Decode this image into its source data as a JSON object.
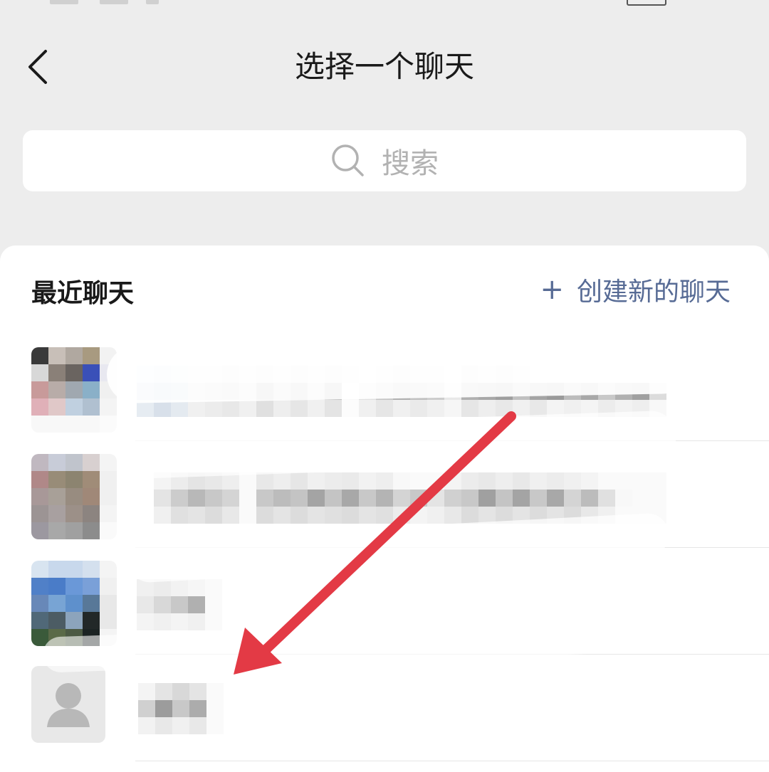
{
  "header": {
    "title": "选择一个聊天",
    "back_icon": "chevron-left-icon"
  },
  "search": {
    "placeholder": "搜索",
    "icon": "search-icon"
  },
  "recent": {
    "section_title": "最近聊天",
    "create_label": "创建新的聊天",
    "create_icon": "plus-icon"
  },
  "colors": {
    "accent": "#576b95",
    "background": "#ededed",
    "annotation_arrow": "#e33a45"
  },
  "chats": [
    {
      "avatar": "blurred-avatar",
      "name": ""
    },
    {
      "avatar": "blurred-avatar",
      "name": ""
    },
    {
      "avatar": "blurred-avatar",
      "name": ""
    },
    {
      "avatar": "default-person-avatar",
      "name": ""
    }
  ]
}
